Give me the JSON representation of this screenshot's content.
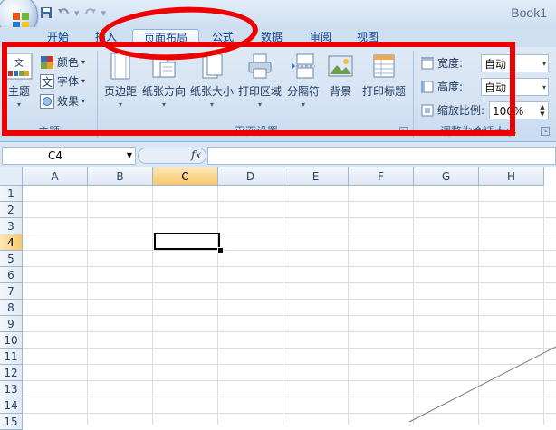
{
  "app": {
    "workbook_title": "Book1"
  },
  "tabs": [
    {
      "label": "开始"
    },
    {
      "label": "插入"
    },
    {
      "label": "页面布局",
      "active": true
    },
    {
      "label": "公式"
    },
    {
      "label": "数据"
    },
    {
      "label": "审阅"
    },
    {
      "label": "视图"
    }
  ],
  "ribbon": {
    "themes": {
      "group_label": "主题",
      "theme_button": "主题",
      "colors": "颜色",
      "fonts": "字体",
      "effects": "效果"
    },
    "page_setup": {
      "group_label": "页面设置",
      "margins": "页边距",
      "orientation": "纸张方向",
      "size": "纸张大小",
      "print_area": "打印区域",
      "breaks": "分隔符",
      "background": "背景",
      "print_titles": "打印标题"
    },
    "scale_to_fit": {
      "group_label": "调整为合适大小",
      "width_label": "宽度:",
      "width_value": "自动",
      "height_label": "高度:",
      "height_value": "自动",
      "scale_label": "缩放比例:",
      "scale_value": "100%"
    }
  },
  "formula_bar": {
    "name_box": "C4",
    "fx": "fx",
    "content": ""
  },
  "grid": {
    "columns": [
      "A",
      "B",
      "C",
      "D",
      "E",
      "F",
      "G",
      "H"
    ],
    "rows": [
      "1",
      "2",
      "3",
      "4",
      "5",
      "6",
      "7",
      "8",
      "9",
      "10",
      "11",
      "12",
      "13",
      "14",
      "15"
    ],
    "selected_column": "C",
    "selected_row": "4"
  },
  "colors": {
    "highlight": "#ee0000",
    "selected_header": "#f9c86d",
    "ribbon": "#d5e3f3"
  }
}
